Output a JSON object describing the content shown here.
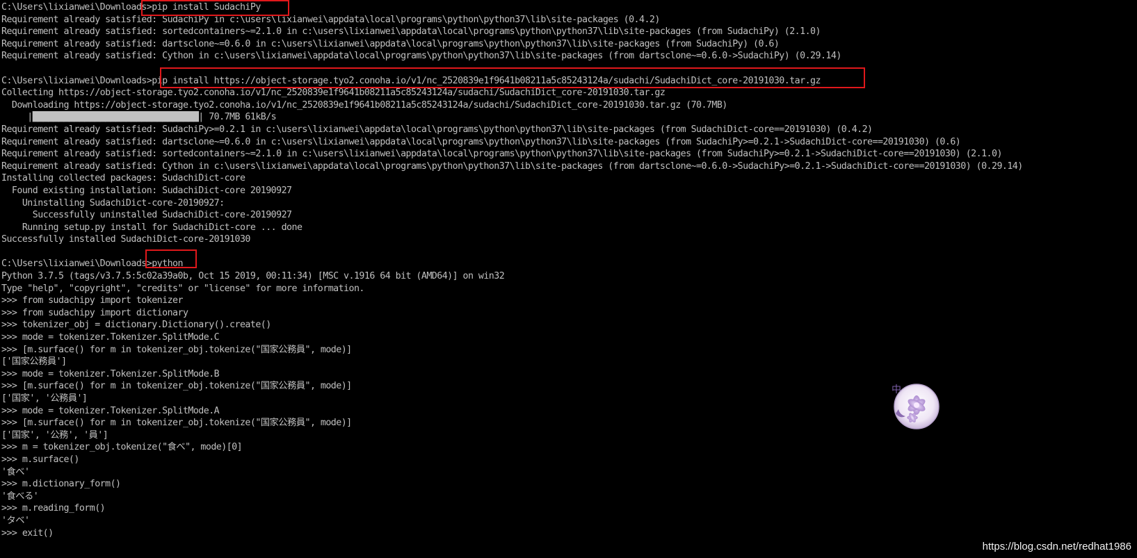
{
  "console": {
    "lines": [
      "C:\\Users\\lixianwei\\Downloads>pip install SudachiPy",
      "Requirement already satisfied: SudachiPy in c:\\users\\lixianwei\\appdata\\local\\programs\\python\\python37\\lib\\site-packages (0.4.2)",
      "Requirement already satisfied: sortedcontainers~=2.1.0 in c:\\users\\lixianwei\\appdata\\local\\programs\\python\\python37\\lib\\site-packages (from SudachiPy) (2.1.0)",
      "Requirement already satisfied: dartsclone~=0.6.0 in c:\\users\\lixianwei\\appdata\\local\\programs\\python\\python37\\lib\\site-packages (from SudachiPy) (0.6)",
      "Requirement already satisfied: Cython in c:\\users\\lixianwei\\appdata\\local\\programs\\python\\python37\\lib\\site-packages (from dartsclone~=0.6.0->SudachiPy) (0.29.14)",
      "",
      "C:\\Users\\lixianwei\\Downloads>pip install https://object-storage.tyo2.conoha.io/v1/nc_2520839e1f9641b08211a5c85243124a/sudachi/SudachiDict_core-20191030.tar.gz",
      "Collecting https://object-storage.tyo2.conoha.io/v1/nc_2520839e1f9641b08211a5c85243124a/sudachi/SudachiDict_core-20191030.tar.gz",
      "  Downloading https://object-storage.tyo2.conoha.io/v1/nc_2520839e1f9641b08211a5c85243124a/sudachi/SudachiDict_core-20191030.tar.gz (70.7MB)",
      "     |████████████████████████████████| 70.7MB 61kB/s",
      "Requirement already satisfied: SudachiPy>=0.2.1 in c:\\users\\lixianwei\\appdata\\local\\programs\\python\\python37\\lib\\site-packages (from SudachiDict-core==20191030) (0.4.2)",
      "Requirement already satisfied: dartsclone~=0.6.0 in c:\\users\\lixianwei\\appdata\\local\\programs\\python\\python37\\lib\\site-packages (from SudachiPy>=0.2.1->SudachiDict-core==20191030) (0.6)",
      "Requirement already satisfied: sortedcontainers~=2.1.0 in c:\\users\\lixianwei\\appdata\\local\\programs\\python\\python37\\lib\\site-packages (from SudachiPy>=0.2.1->SudachiDict-core==20191030) (2.1.0)",
      "Requirement already satisfied: Cython in c:\\users\\lixianwei\\appdata\\local\\programs\\python\\python37\\lib\\site-packages (from dartsclone~=0.6.0->SudachiPy>=0.2.1->SudachiDict-core==20191030) (0.29.14)",
      "Installing collected packages: SudachiDict-core",
      "  Found existing installation: SudachiDict-core 20190927",
      "    Uninstalling SudachiDict-core-20190927:",
      "      Successfully uninstalled SudachiDict-core-20190927",
      "    Running setup.py install for SudachiDict-core ... done",
      "Successfully installed SudachiDict-core-20191030",
      "",
      "C:\\Users\\lixianwei\\Downloads>python",
      "Python 3.7.5 (tags/v3.7.5:5c02a39a0b, Oct 15 2019, 00:11:34) [MSC v.1916 64 bit (AMD64)] on win32",
      "Type \"help\", \"copyright\", \"credits\" or \"license\" for more information.",
      ">>> from sudachipy import tokenizer",
      ">>> from sudachipy import dictionary",
      ">>> tokenizer_obj = dictionary.Dictionary().create()",
      ">>> mode = tokenizer.Tokenizer.SplitMode.C",
      ">>> [m.surface() for m in tokenizer_obj.tokenize(\"国家公務員\", mode)]",
      "['国家公務員']",
      ">>> mode = tokenizer.Tokenizer.SplitMode.B",
      ">>> [m.surface() for m in tokenizer_obj.tokenize(\"国家公務員\", mode)]",
      "['国家', '公務員']",
      ">>> mode = tokenizer.Tokenizer.SplitMode.A",
      ">>> [m.surface() for m in tokenizer_obj.tokenize(\"国家公務員\", mode)]",
      "['国家', '公務', '員']",
      ">>> m = tokenizer_obj.tokenize(\"食べ\", mode)[0]",
      ">>> m.surface()",
      "'食べ'",
      ">>> m.dictionary_form()",
      "'食べる'",
      ">>> m.reading_form()",
      "'タベ'",
      ">>> exit()"
    ]
  },
  "ime_indicator": {
    "label": "中"
  },
  "watermark": {
    "text": "https://blog.csdn.net/redhat1986"
  },
  "colors": {
    "background": "#000000",
    "text": "#c0c0c0",
    "highlight_box": "#e0181b"
  }
}
